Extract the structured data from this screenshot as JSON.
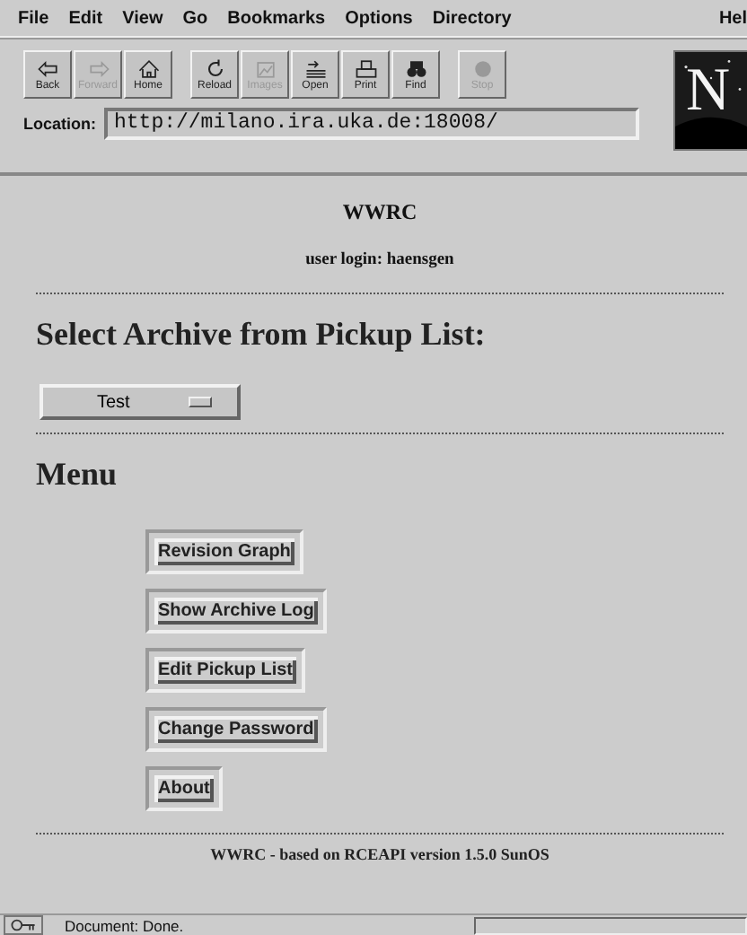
{
  "menu_bar": [
    "File",
    "Edit",
    "View",
    "Go",
    "Bookmarks",
    "Options",
    "Directory"
  ],
  "menu_help": "Hel",
  "toolbar_groups": [
    [
      {
        "label": "Back",
        "disabled": false
      },
      {
        "label": "Forward",
        "disabled": true
      },
      {
        "label": "Home",
        "disabled": false
      }
    ],
    [
      {
        "label": "Reload",
        "disabled": false
      },
      {
        "label": "Images",
        "disabled": true
      },
      {
        "label": "Open",
        "disabled": false
      },
      {
        "label": "Print",
        "disabled": false
      },
      {
        "label": "Find",
        "disabled": false
      }
    ],
    [
      {
        "label": "Stop",
        "disabled": true
      }
    ]
  ],
  "logo": {
    "letter": "N"
  },
  "location": {
    "label": "Location:",
    "value": "http://milano.ira.uka.de:18008/"
  },
  "page": {
    "title": "WWRC",
    "user_login": "user login: haensgen",
    "select_heading": "Select Archive from Pickup List:",
    "archive_select": "Test",
    "menu_heading": "Menu",
    "menu_buttons": [
      "Revision Graph",
      "Show Archive Log",
      "Edit Pickup List",
      "Change Password",
      "About"
    ],
    "footer": "WWRC - based on RCEAPI version 1.5.0 SunOS"
  },
  "status_bar": {
    "text": "Document: Done."
  }
}
